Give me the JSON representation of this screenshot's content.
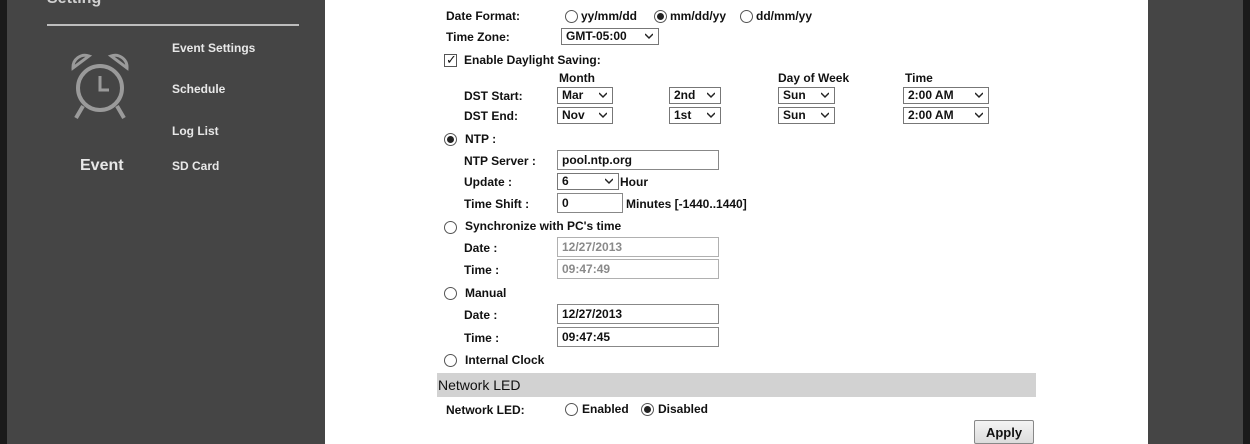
{
  "sidebar": {
    "title": "Setting",
    "links": [
      "Event Settings",
      "Schedule",
      "Log List",
      "SD Card"
    ],
    "section_label": "Event"
  },
  "date_format": {
    "label": "Date Format:",
    "options": [
      "yy/mm/dd",
      "mm/dd/yy",
      "dd/mm/yy"
    ],
    "selected": "mm/dd/yy"
  },
  "time_zone": {
    "label": "Time Zone:",
    "value": "GMT-05:00"
  },
  "daylight": {
    "label": "Enable Daylight Saving:",
    "checked": true,
    "headers": {
      "month": "Month",
      "day_of_week": "Day of Week",
      "time": "Time"
    },
    "start": {
      "label": "DST Start:",
      "month": "Mar",
      "week": "2nd",
      "day": "Sun",
      "time": "2:00 AM"
    },
    "end": {
      "label": "DST End:",
      "month": "Nov",
      "week": "1st",
      "day": "Sun",
      "time": "2:00 AM"
    }
  },
  "ntp": {
    "label": "NTP :",
    "selected": true,
    "server_label": "NTP Server :",
    "server_value": "pool.ntp.org",
    "update_label": "Update :",
    "update_value": "6",
    "update_unit": "Hour",
    "shift_label": "Time Shift :",
    "shift_value": "0",
    "shift_unit": "Minutes [-1440..1440]"
  },
  "sync_pc": {
    "label": "Synchronize with PC's time",
    "date_label": "Date :",
    "date_value": "12/27/2013",
    "time_label": "Time :",
    "time_value": "09:47:49"
  },
  "manual": {
    "label": "Manual",
    "date_label": "Date :",
    "date_value": "12/27/2013",
    "time_label": "Time :",
    "time_value": "09:47:45"
  },
  "internal_clock": {
    "label": "Internal Clock"
  },
  "network_led": {
    "section_title": "Network LED",
    "label": "Network LED:",
    "options": [
      "Enabled",
      "Disabled"
    ],
    "selected": "Disabled"
  },
  "apply_label": "Apply"
}
